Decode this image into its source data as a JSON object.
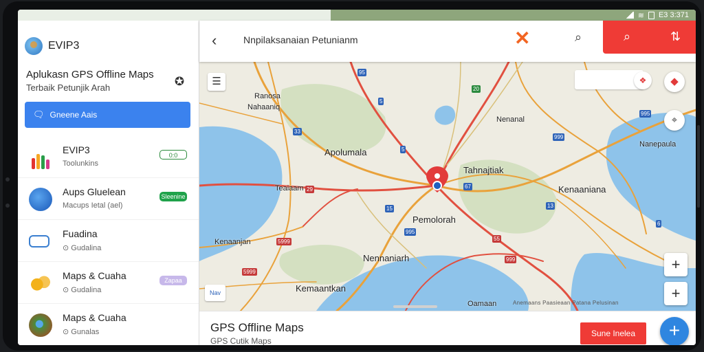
{
  "status": {
    "time": "E3 3:371"
  },
  "sidebar": {
    "app_name": "EVIP3",
    "title": "Aplukasn GPS Offline Maps",
    "subtitle": "Terbaik Petunjik Arah",
    "cta_label": "Gneene Aais",
    "items": [
      {
        "title": "EVIP3",
        "subtitle": "Toolunkins",
        "badge": "0:0",
        "badge_style": "outline",
        "icon": "colored-bars-icon"
      },
      {
        "title": "Aups Gluelean",
        "subtitle": "Macups Ietal (ael)",
        "badge": "Sleenine",
        "badge_style": "green",
        "icon": "blue-globe-icon"
      },
      {
        "title": "Fuadina",
        "subtitle": "Gudalina",
        "badge": "",
        "badge_style": "",
        "icon": "ticket-icon"
      },
      {
        "title": "Maps & Cuaha",
        "subtitle": "Gudalina",
        "badge": "Zapaa",
        "badge_style": "purple",
        "icon": "bubbles-icon"
      },
      {
        "title": "Maps & Cuaha",
        "subtitle": "Gunalas",
        "badge": "",
        "badge_style": "",
        "icon": "earth-pin-icon"
      }
    ]
  },
  "search": {
    "query": "Nnpilaksanaian Petunianm"
  },
  "map": {
    "labels": [
      {
        "text": "Ranosa",
        "size": "normal"
      },
      {
        "text": "Nahaaniq",
        "size": "normal"
      },
      {
        "text": "Apolumala",
        "size": "big"
      },
      {
        "text": "Teaiaam",
        "size": "normal"
      },
      {
        "text": "Nenanal",
        "size": "normal"
      },
      {
        "text": "Tahnajtiak",
        "size": "big"
      },
      {
        "text": "Kenaaniana",
        "size": "big"
      },
      {
        "text": "Pemolorah",
        "size": "big"
      },
      {
        "text": "Kenaanjan",
        "size": "normal"
      },
      {
        "text": "Nennaniarh",
        "size": "big"
      },
      {
        "text": "Kemaantkan",
        "size": "big"
      },
      {
        "text": "Nanepaula",
        "size": "normal"
      },
      {
        "text": "Oamaan",
        "size": "normal"
      }
    ],
    "credits": "Anemaans Paasieaan  Patana Pelusinan",
    "chip": "Nav"
  },
  "bottom": {
    "title": "GPS Offline Maps",
    "subtitle": "GPS Cutik Maps",
    "button": "Sune Inelea"
  },
  "colors": {
    "accent_red": "#ef3b36",
    "accent_blue": "#3b82ee"
  }
}
